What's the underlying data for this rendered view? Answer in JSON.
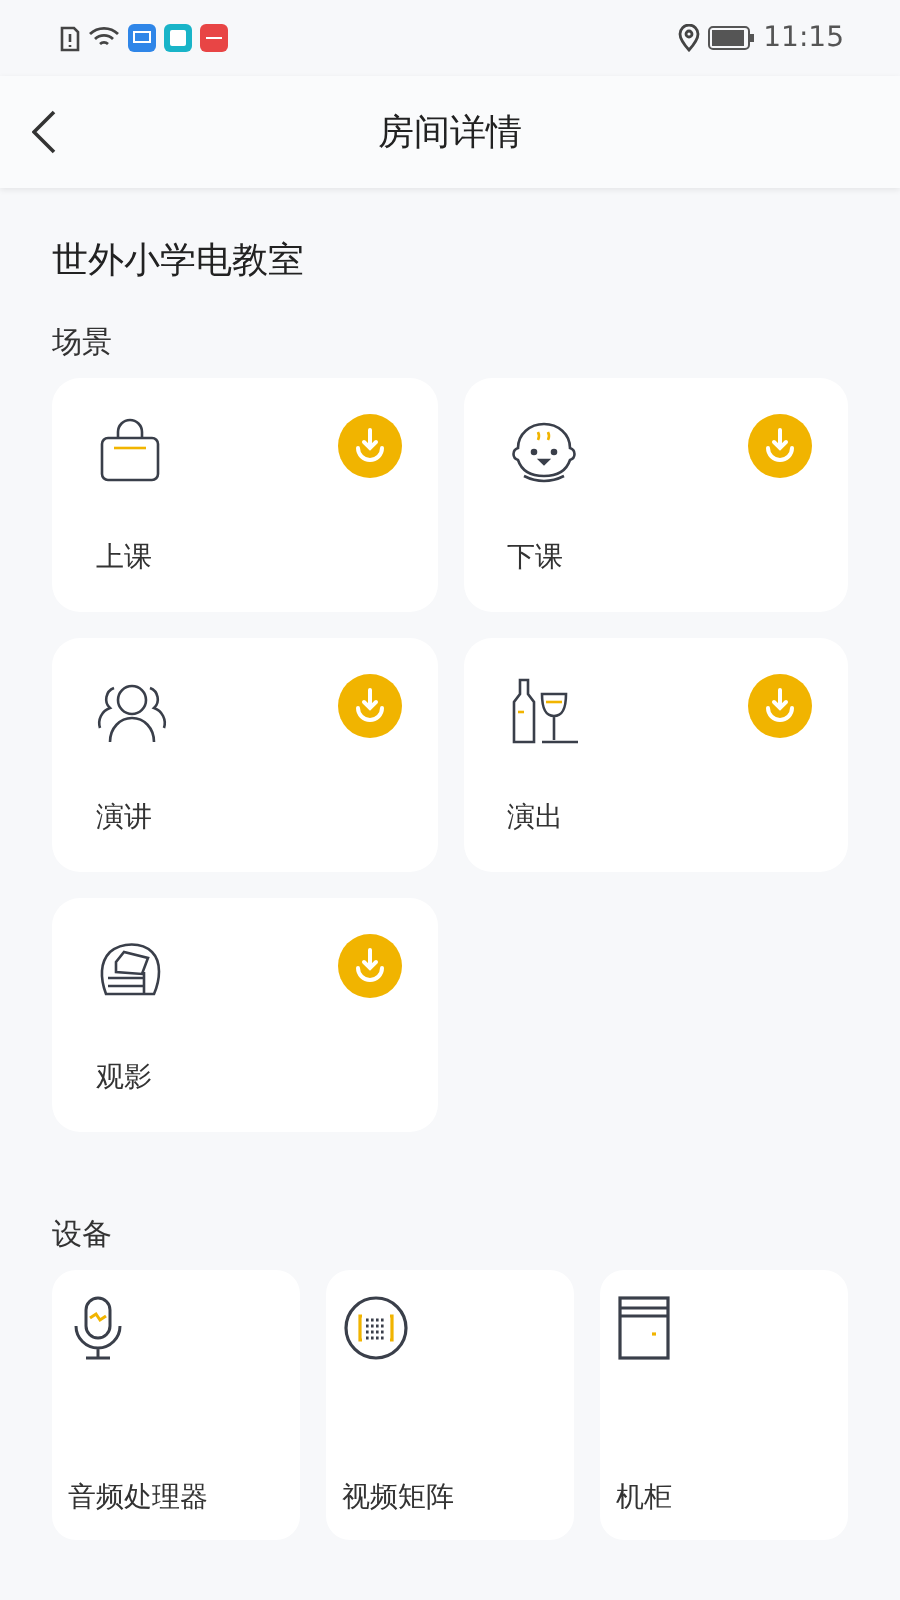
{
  "status_bar": {
    "time": "11:15"
  },
  "header": {
    "title": "房间详情"
  },
  "room_name": "世外小学电教室",
  "scenes_heading": "场景",
  "scenes": [
    {
      "label": "上课",
      "kind": "bag"
    },
    {
      "label": "下课",
      "kind": "baby"
    },
    {
      "label": "演讲",
      "kind": "people"
    },
    {
      "label": "演出",
      "kind": "drinks"
    },
    {
      "label": "观影",
      "kind": "armchair"
    }
  ],
  "devices_heading": "设备",
  "devices": [
    {
      "label": "音频处理器",
      "kind": "mic"
    },
    {
      "label": "视频矩阵",
      "kind": "matrix"
    },
    {
      "label": "机柜",
      "kind": "cabinet"
    }
  ]
}
